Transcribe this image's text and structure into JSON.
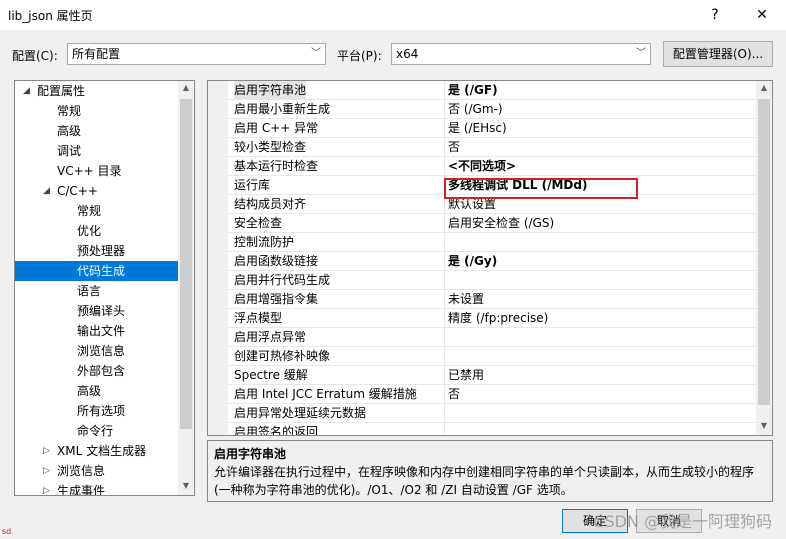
{
  "window": {
    "title": "lib_json 属性页",
    "help": "?",
    "close": "✕"
  },
  "config": {
    "config_label": "配置(C):",
    "config_value": "所有配置",
    "platform_label": "平台(P):",
    "platform_value": "x64",
    "manager_button": "配置管理器(O)..."
  },
  "tree": {
    "items": [
      {
        "label": "配置属性",
        "expand": "◢"
      },
      {
        "label": "常规"
      },
      {
        "label": "高级"
      },
      {
        "label": "调试"
      },
      {
        "label": "VC++ 目录"
      },
      {
        "label": "C/C++",
        "expand": "◢"
      },
      {
        "label": "常规"
      },
      {
        "label": "优化"
      },
      {
        "label": "预处理器"
      },
      {
        "label": "代码生成"
      },
      {
        "label": "语言"
      },
      {
        "label": "预编译头"
      },
      {
        "label": "输出文件"
      },
      {
        "label": "浏览信息"
      },
      {
        "label": "外部包含"
      },
      {
        "label": "高级"
      },
      {
        "label": "所有选项"
      },
      {
        "label": "命令行"
      },
      {
        "label": "XML 文档生成器",
        "expand": "▷"
      },
      {
        "label": "浏览信息",
        "expand": "▷"
      },
      {
        "label": "生成事件",
        "expand": "▷"
      }
    ]
  },
  "grid": {
    "rows": [
      {
        "name": "启用字符串池",
        "value": "是 (/GF)",
        "bold": true
      },
      {
        "name": "启用最小重新生成",
        "value": "否 (/Gm-)"
      },
      {
        "name": "启用 C++ 异常",
        "value": "是 (/EHsc)"
      },
      {
        "name": "较小类型检查",
        "value": "否"
      },
      {
        "name": "基本运行时检查",
        "value": "<不同选项>",
        "bold": true
      },
      {
        "name": "运行库",
        "value": "多线程调试 DLL (/MDd)",
        "bold": true
      },
      {
        "name": "结构成员对齐",
        "value": "默认设置"
      },
      {
        "name": "安全检查",
        "value": "启用安全检查 (/GS)"
      },
      {
        "name": "控制流防护",
        "value": ""
      },
      {
        "name": "启用函数级链接",
        "value": "是 (/Gy)",
        "bold": true
      },
      {
        "name": "启用并行代码生成",
        "value": ""
      },
      {
        "name": "启用增强指令集",
        "value": "未设置"
      },
      {
        "name": "浮点模型",
        "value": "精度 (/fp:precise)"
      },
      {
        "name": "启用浮点异常",
        "value": ""
      },
      {
        "name": "创建可热修补映像",
        "value": ""
      },
      {
        "name": "Spectre 缓解",
        "value": "已禁用"
      },
      {
        "name": "启用 Intel JCC Erratum 缓解措施",
        "value": "否"
      },
      {
        "name": "启用异常处理延续元数据",
        "value": ""
      },
      {
        "name": "启用签名的返回",
        "value": ""
      }
    ]
  },
  "description": {
    "title": "启用字符串池",
    "text": "允许编译器在执行过程中，在程序映像和内存中创建相同字符串的单个只读副本，从而生成较小的程序(一种称为字符串池的优化)。/O1、/O2 和 /ZI 自动设置 /GF 选项。"
  },
  "buttons": {
    "ok": "确定",
    "cancel": "取消"
  },
  "overlay": {
    "watermark": "CSDN @我是一阿理狗码",
    "corner": "sd"
  }
}
